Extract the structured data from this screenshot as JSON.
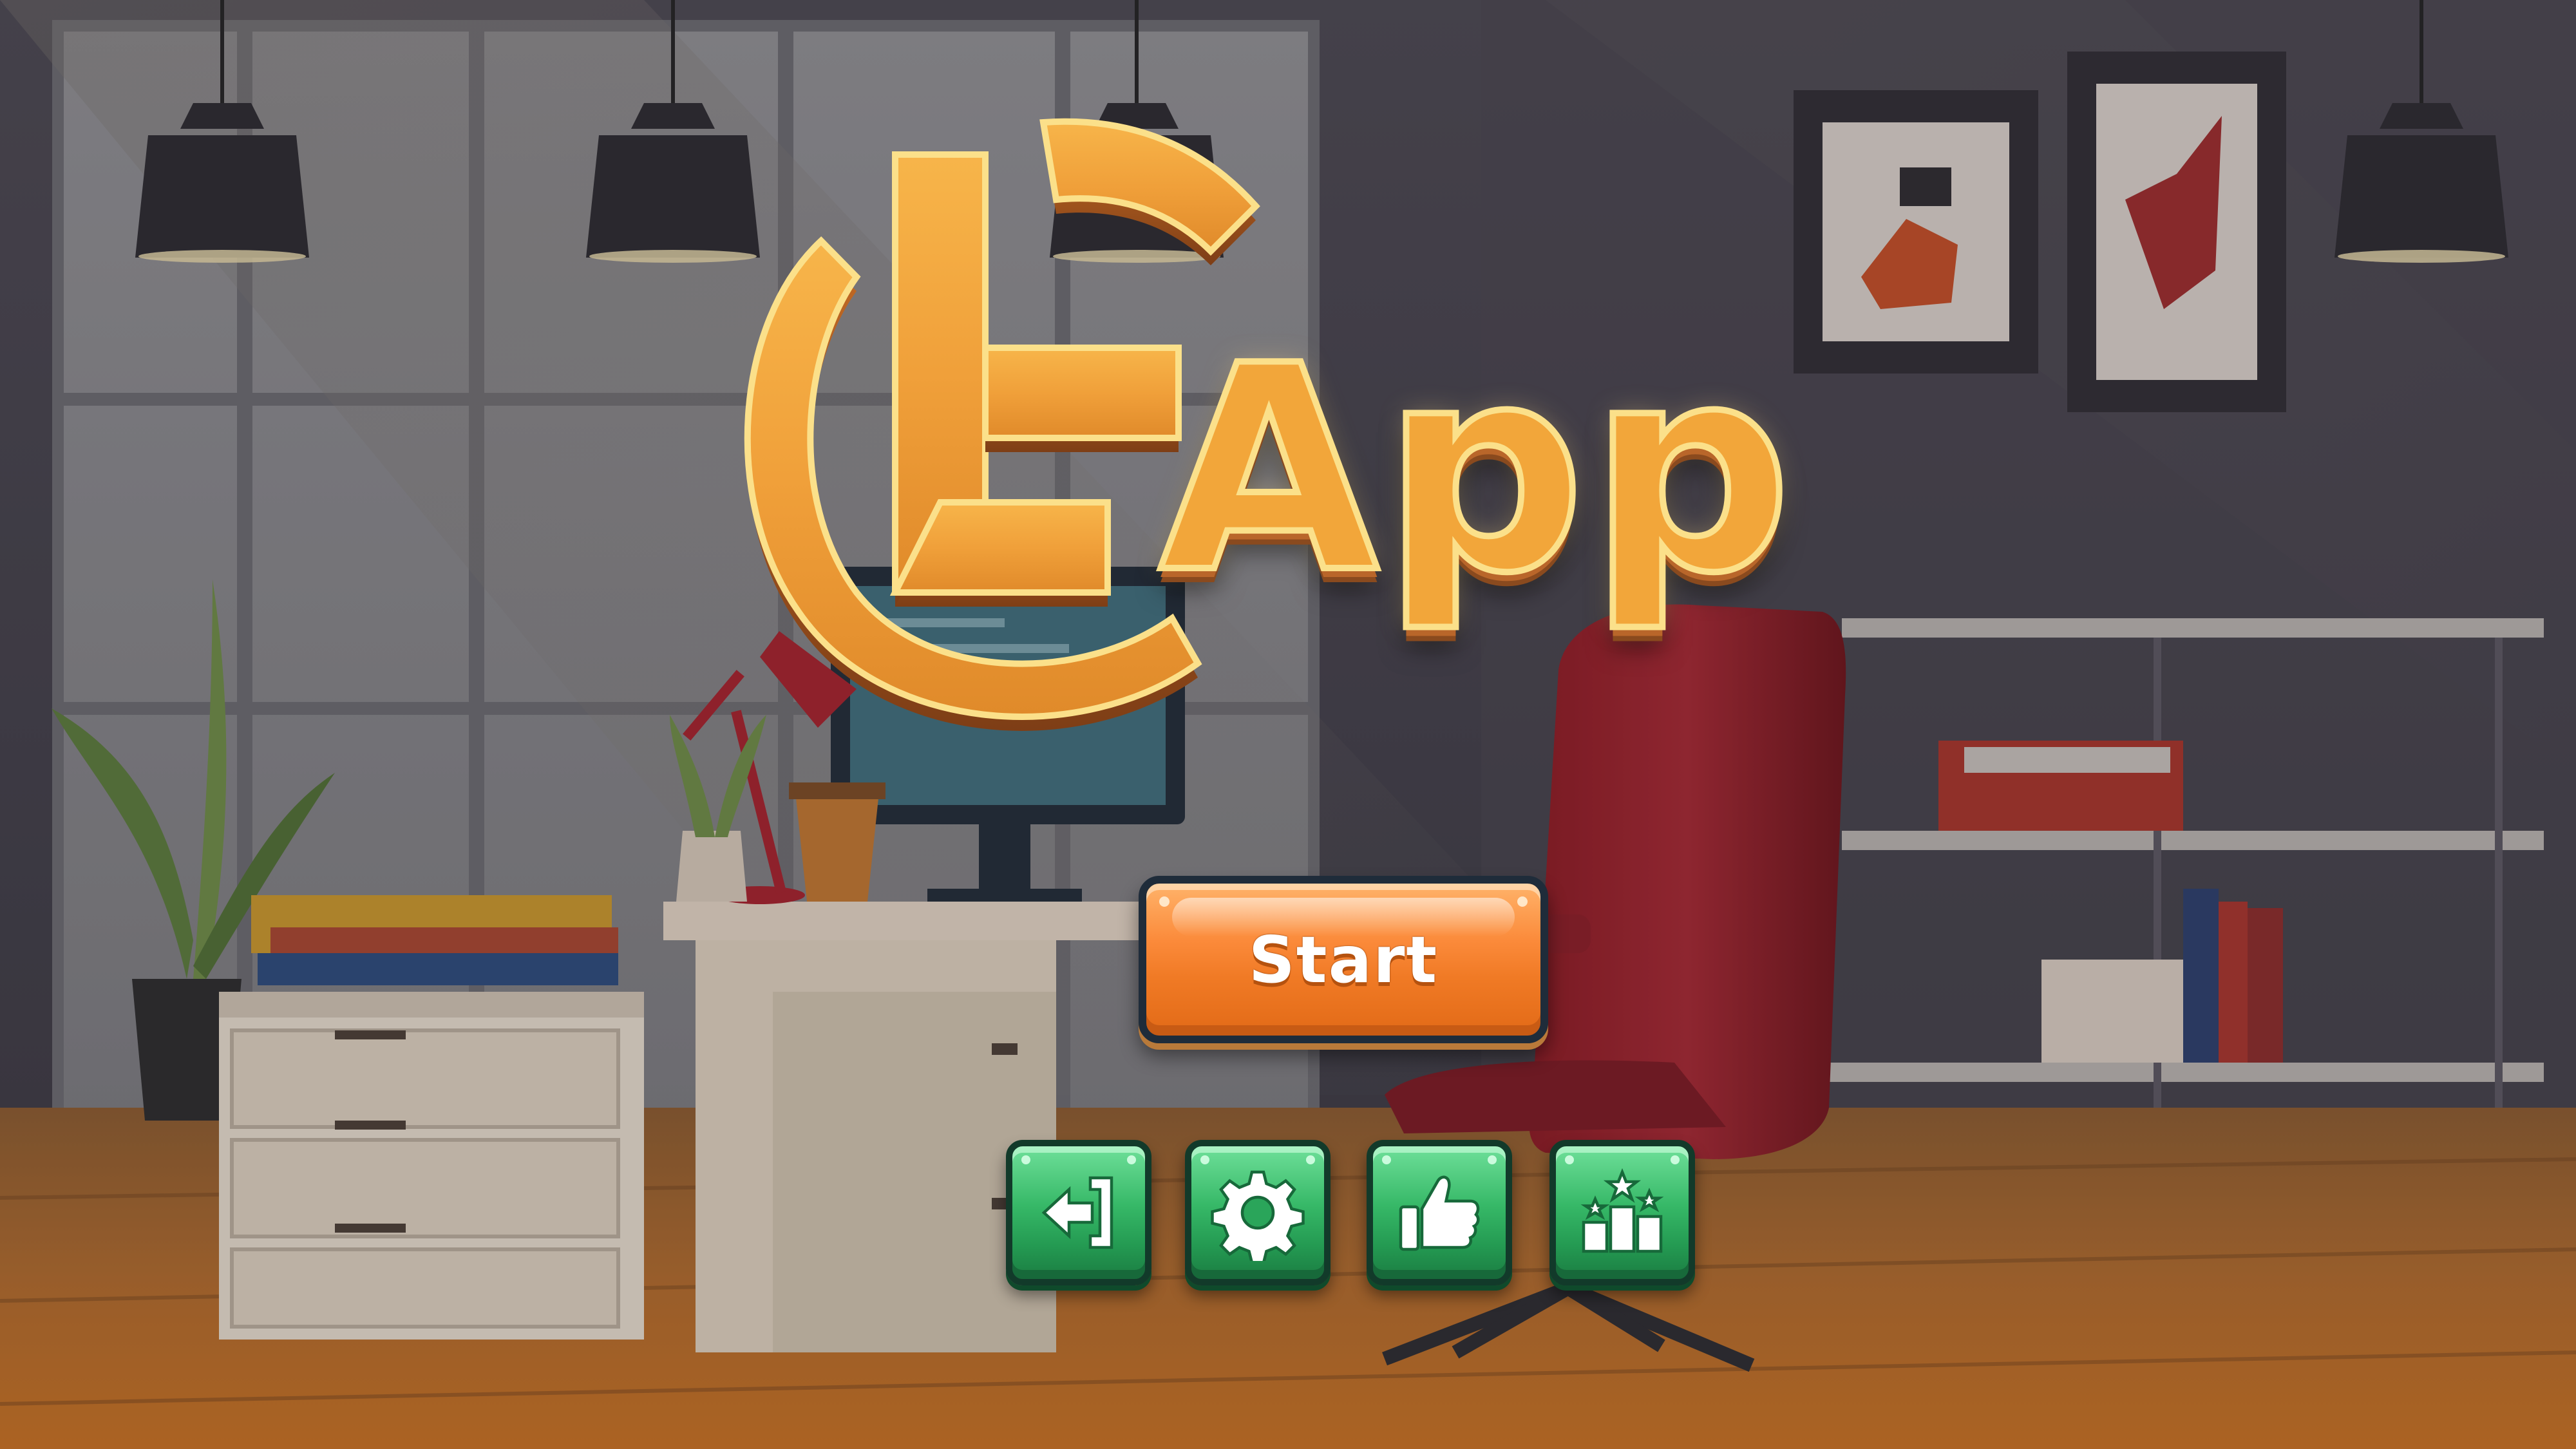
{
  "app": {
    "title": "App"
  },
  "menu": {
    "start_label": "Start"
  },
  "icon_buttons": [
    {
      "icon": "exit-icon"
    },
    {
      "icon": "gear-icon"
    },
    {
      "icon": "thumbs-up-icon"
    },
    {
      "icon": "leaderboard-icon"
    }
  ],
  "colors": {
    "logo_gold": "#f2a63a",
    "start_orange": "#f07a25",
    "icon_green": "#2fae5e"
  }
}
